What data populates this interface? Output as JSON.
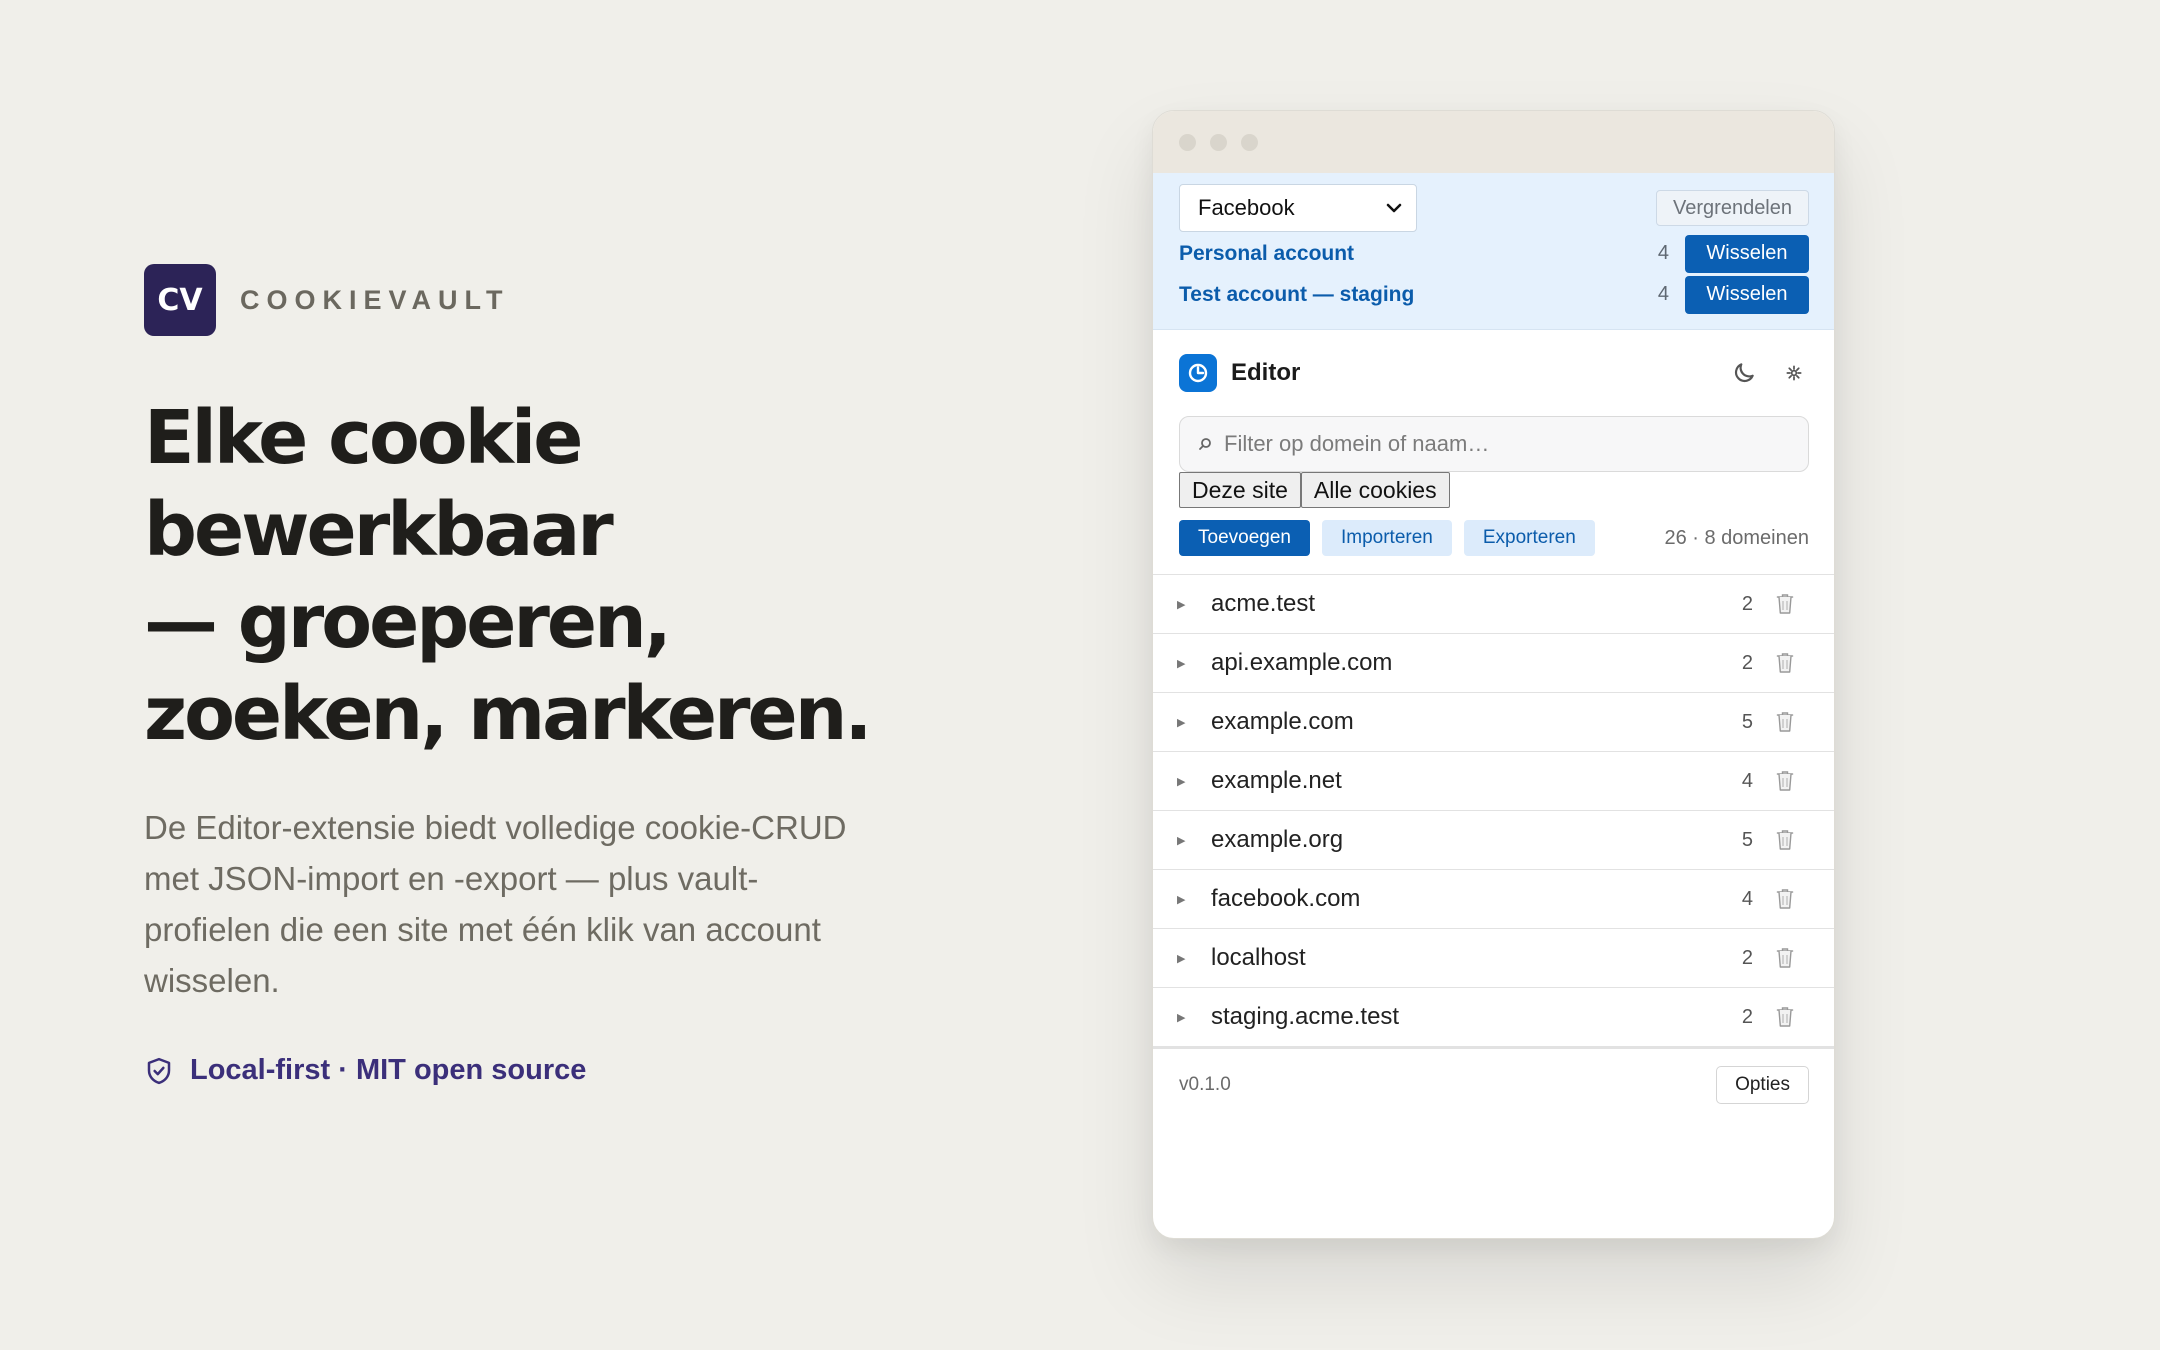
{
  "hero": {
    "logo_text": "CV",
    "brand": "COOKIEVAULT",
    "headline": [
      "Elke cookie",
      "bewerkbaar",
      "— groeperen,",
      "zoeken, markeren."
    ],
    "description": "De Editor-extensie biedt volledige cookie-CRUD met JSON-import en -export — plus vault-profielen die een site met één klik van account wisselen.",
    "badge": "Local-first · MIT open source",
    "badge_icon": "shield-check-icon"
  },
  "vault": {
    "selected_site": "Facebook",
    "lock_label": "Vergrendelen",
    "accounts": [
      {
        "name": "Personal account",
        "count": "4",
        "action": "Wisselen"
      },
      {
        "name": "Test account — staging",
        "count": "4",
        "action": "Wisselen"
      }
    ]
  },
  "editor": {
    "title": "Editor",
    "search_placeholder": "Filter op domein of naam…",
    "scope": [
      "Deze site",
      "Alle cookies"
    ],
    "actions": {
      "add": "Toevoegen",
      "import": "Importeren",
      "export": "Exporteren"
    },
    "stats": "26 · 8 domeinen",
    "domains": [
      {
        "name": "acme.test",
        "count": "2"
      },
      {
        "name": "api.example.com",
        "count": "2"
      },
      {
        "name": "example.com",
        "count": "5"
      },
      {
        "name": "example.net",
        "count": "4"
      },
      {
        "name": "example.org",
        "count": "5"
      },
      {
        "name": "facebook.com",
        "count": "4"
      },
      {
        "name": "localhost",
        "count": "2"
      },
      {
        "name": "staging.acme.test",
        "count": "2"
      }
    ],
    "version": "v0.1.0",
    "options_label": "Opties"
  },
  "colors": {
    "accent": "#0b5fb3",
    "brand": "#2c2357",
    "vault_bg": "#e5f1fd",
    "page_bg": "#f0efea"
  }
}
